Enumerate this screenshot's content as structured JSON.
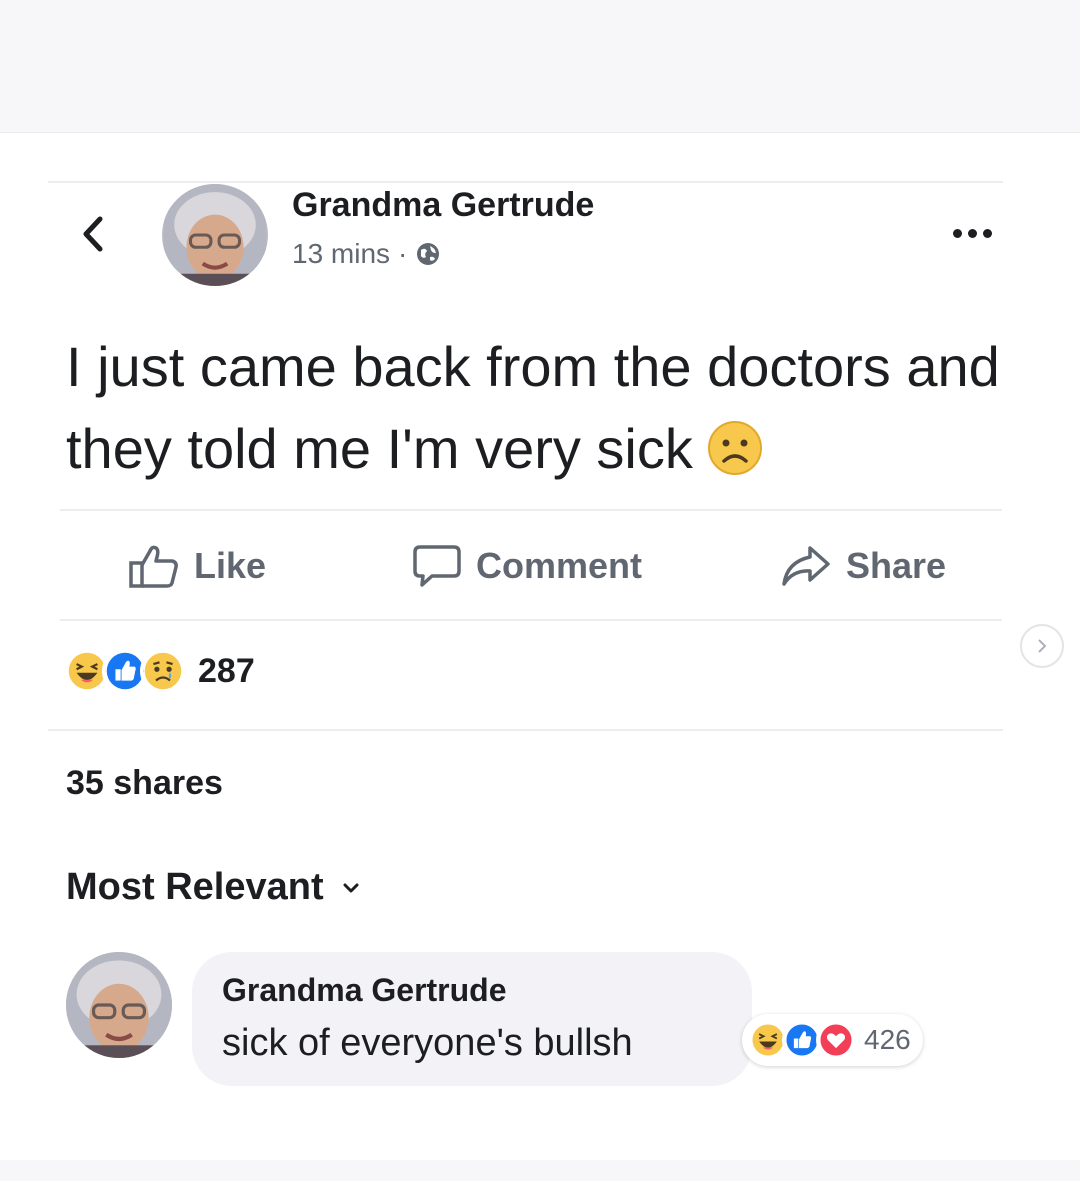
{
  "post": {
    "author": "Grandma Gertrude",
    "time": "13 mins",
    "meta_separator": "·",
    "audience_icon": "globe-icon",
    "text": "I just came back from the doctors and they told me I'm very sick",
    "emoji": "sad-face-emoji"
  },
  "actions": {
    "like": "Like",
    "comment": "Comment",
    "share": "Share"
  },
  "reactions": {
    "icons": [
      "haha-icon",
      "like-icon",
      "sad-icon"
    ],
    "count": "287"
  },
  "shares": "35 shares",
  "comments": {
    "sort_label": "Most Relevant",
    "items": [
      {
        "author": "Grandma Gertrude",
        "text": "sick of everyone's bullsh",
        "reaction_icons": [
          "haha-icon",
          "like-icon",
          "love-icon"
        ],
        "reaction_count": "426"
      }
    ]
  },
  "colors": {
    "text": "#1c1e21",
    "secondary_text": "#606770",
    "like_blue": "#1877f2",
    "love_red": "#f33e58",
    "emoji_yellow": "#f7c84b",
    "bubble_bg": "#f2f2f7"
  }
}
